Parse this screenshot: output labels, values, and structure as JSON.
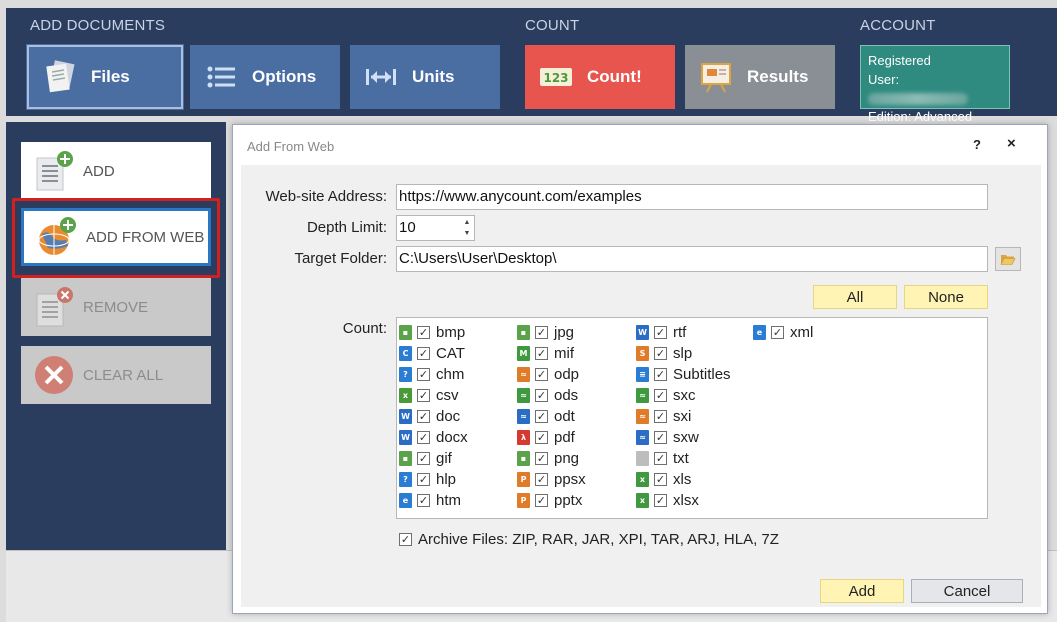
{
  "ribbon": {
    "sections": {
      "add_documents": "ADD DOCUMENTS",
      "count": "COUNT",
      "account": "ACCOUNT"
    },
    "buttons": {
      "files": "Files",
      "options": "Options",
      "units": "Units",
      "count": "Count!",
      "results": "Results"
    },
    "account": {
      "line1": "Registered",
      "user_label": "User:",
      "edition": "Edition: Advanced"
    },
    "colors": {
      "ribbon_bg": "#2a3d5f",
      "blue_button": "#4a6ea2",
      "count_button": "#e8554e",
      "results_button": "#8a8f96",
      "account_bg": "#2f8a80"
    }
  },
  "left_panel": {
    "add": "ADD",
    "add_from_web": "ADD FROM WEB",
    "remove": "REMOVE",
    "clear_all": "CLEAR ALL"
  },
  "dialog": {
    "title": "Add From Web",
    "help": "?",
    "close": "×",
    "website_label": "Web-site Address:",
    "website_value": "https://www.anycount.com/examples",
    "depth_label": "Depth Limit:",
    "depth_value": "10",
    "folder_label": "Target Folder:",
    "folder_value": "C:\\Users\\User\\Desktop\\",
    "all_button": "All",
    "none_button": "None",
    "count_label": "Count:",
    "file_types": [
      [
        {
          "name": "bmp",
          "icon": "image-icon",
          "color": "#5aa34a"
        },
        {
          "name": "CAT",
          "icon": "cat-icon",
          "color": "#2b7cd3"
        },
        {
          "name": "chm",
          "icon": "help-icon",
          "color": "#2b7cd3"
        },
        {
          "name": "csv",
          "icon": "csv-icon",
          "color": "#4a9a3a"
        },
        {
          "name": "doc",
          "icon": "word-icon",
          "color": "#2b6cc4"
        },
        {
          "name": "docx",
          "icon": "word-icon",
          "color": "#2b6cc4"
        },
        {
          "name": "gif",
          "icon": "image-icon",
          "color": "#5aa34a"
        },
        {
          "name": "hlp",
          "icon": "help-icon",
          "color": "#2b7cd3"
        },
        {
          "name": "htm",
          "icon": "web-icon",
          "color": "#2b7cd3"
        }
      ],
      [
        {
          "name": "jpg",
          "icon": "image-icon",
          "color": "#5aa34a"
        },
        {
          "name": "mif",
          "icon": "framemaker-icon",
          "color": "#3f9a3f"
        },
        {
          "name": "odp",
          "icon": "presentation-icon",
          "color": "#e07b28"
        },
        {
          "name": "ods",
          "icon": "spreadsheet-icon",
          "color": "#3f9a3f"
        },
        {
          "name": "odt",
          "icon": "text-doc-icon",
          "color": "#2b6cc4"
        },
        {
          "name": "pdf",
          "icon": "pdf-icon",
          "color": "#d63a2f"
        },
        {
          "name": "png",
          "icon": "image-icon",
          "color": "#5aa34a"
        },
        {
          "name": "ppsx",
          "icon": "powerpoint-icon",
          "color": "#e07b28"
        },
        {
          "name": "pptx",
          "icon": "powerpoint-icon",
          "color": "#e07b28"
        }
      ],
      [
        {
          "name": "rtf",
          "icon": "word-icon",
          "color": "#2b6cc4"
        },
        {
          "name": "slp",
          "icon": "slp-icon",
          "color": "#e07b28"
        },
        {
          "name": "Subtitles",
          "icon": "subtitles-icon",
          "color": "#2b7cd3"
        },
        {
          "name": "sxc",
          "icon": "spreadsheet-icon",
          "color": "#3f9a3f"
        },
        {
          "name": "sxi",
          "icon": "presentation-icon",
          "color": "#e07b28"
        },
        {
          "name": "sxw",
          "icon": "text-doc-icon",
          "color": "#2b6cc4"
        },
        {
          "name": "txt",
          "icon": "text-file-icon",
          "color": "#bdbdbd"
        },
        {
          "name": "xls",
          "icon": "excel-icon",
          "color": "#3f9a3f"
        },
        {
          "name": "xlsx",
          "icon": "excel-icon",
          "color": "#3f9a3f"
        }
      ],
      [
        {
          "name": "xml",
          "icon": "web-icon",
          "color": "#2b7cd3"
        }
      ]
    ],
    "archive_label": "Archive Files: ZIP, RAR, JAR, XPI, TAR, ARJ, HLA, 7Z",
    "add_button": "Add",
    "cancel_button": "Cancel"
  }
}
